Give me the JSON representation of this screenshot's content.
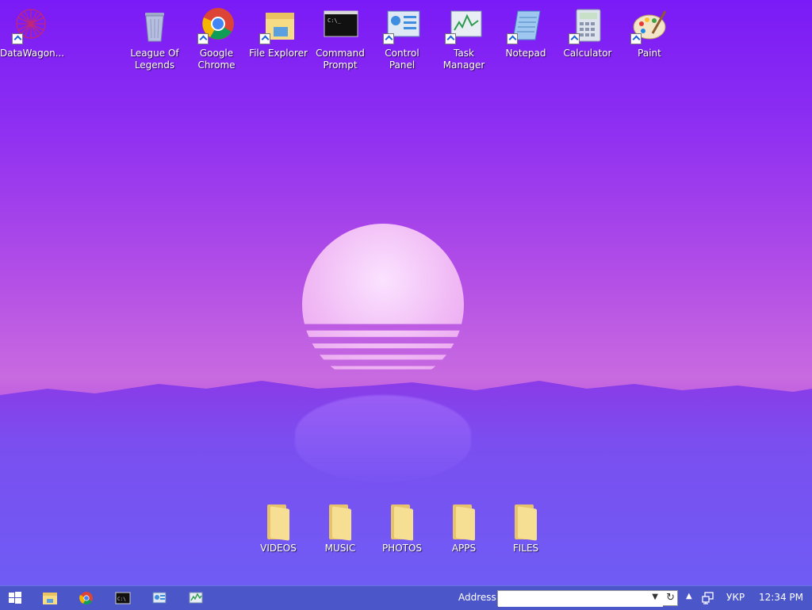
{
  "desktop_icons": [
    {
      "label": "DataWagon...",
      "icon": "datawagon-icon"
    },
    {
      "label": "League Of Legends",
      "icon": "recycle-bin-icon"
    },
    {
      "label": "Google Chrome",
      "icon": "chrome-icon"
    },
    {
      "label": "File Explorer",
      "icon": "file-explorer-icon"
    },
    {
      "label": "Command Prompt",
      "icon": "command-prompt-icon"
    },
    {
      "label": "Control Panel",
      "icon": "control-panel-icon"
    },
    {
      "label": "Task Manager",
      "icon": "task-manager-icon"
    },
    {
      "label": "Notepad",
      "icon": "notepad-icon"
    },
    {
      "label": "Calculator",
      "icon": "calculator-icon"
    },
    {
      "label": "Paint",
      "icon": "paint-icon"
    }
  ],
  "folders": [
    {
      "label": "VIDEOS"
    },
    {
      "label": "MUSIC"
    },
    {
      "label": "PHOTOS"
    },
    {
      "label": "APPS"
    },
    {
      "label": "FILES"
    }
  ],
  "taskbar": {
    "address_label": "Address",
    "address_value": "",
    "language": "УКР",
    "time": "12:34 PM"
  },
  "colors": {
    "taskbar": "#4b57c9",
    "sky_top": "#7a1af6",
    "sun": "#f0b8f4"
  }
}
